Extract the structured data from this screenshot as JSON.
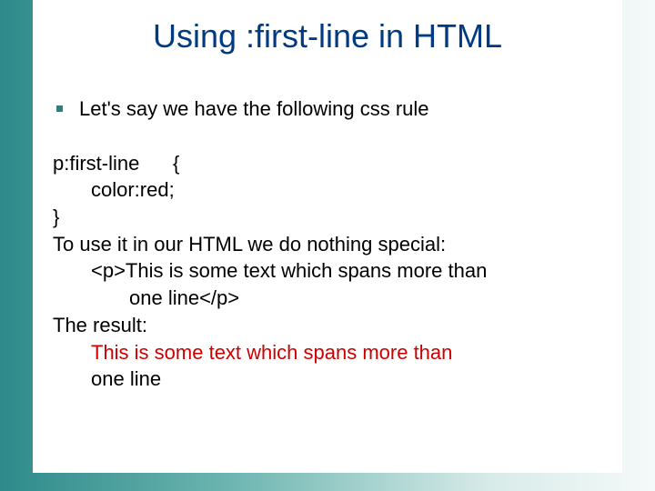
{
  "title": "Using :first-line in HTML",
  "bullet": "Let's say we have the following css rule",
  "code": {
    "l1": "p:first-line      {",
    "l2": "color:red;",
    "l3": "}",
    "l4": "To use it in our HTML we do nothing special:",
    "l5": "<p>This is some text which spans more than",
    "l6": "one line</p>",
    "l7": "The result:",
    "l8a": "This is some text which spans more than",
    "l8b": "one line"
  }
}
